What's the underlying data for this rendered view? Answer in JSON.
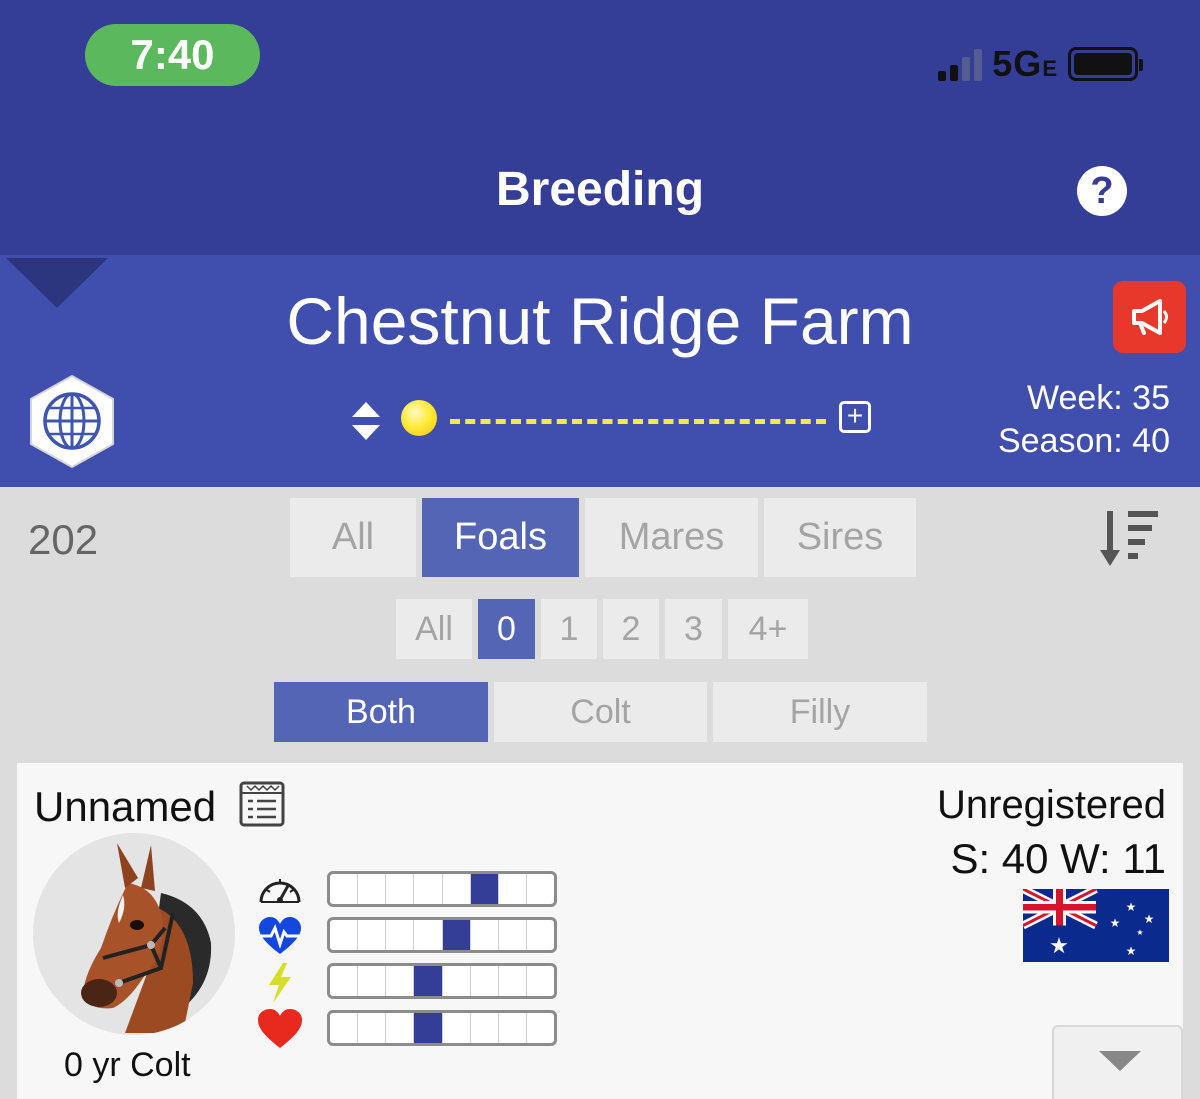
{
  "status_bar": {
    "time": "7:40",
    "network": "5G",
    "network_suffix": "E",
    "icons": [
      "signal-icon",
      "battery-icon"
    ]
  },
  "nav": {
    "title": "Breeding",
    "help_label": "?"
  },
  "farm": {
    "name": "Chestnut Ridge Farm",
    "week_label": "Week: 35",
    "season_label": "Season: 40",
    "plus_label": "+"
  },
  "filters": {
    "count": "202",
    "type_tabs": [
      {
        "label": "All",
        "active": false
      },
      {
        "label": "Foals",
        "active": true
      },
      {
        "label": "Mares",
        "active": false
      },
      {
        "label": "Sires",
        "active": false
      }
    ],
    "age_tabs": [
      {
        "label": "All",
        "active": false
      },
      {
        "label": "0",
        "active": true
      },
      {
        "label": "1",
        "active": false
      },
      {
        "label": "2",
        "active": false
      },
      {
        "label": "3",
        "active": false
      },
      {
        "label": "4+",
        "active": false
      }
    ],
    "sex_tabs": [
      {
        "label": "Both",
        "active": true
      },
      {
        "label": "Colt",
        "active": false
      },
      {
        "label": "Filly",
        "active": false
      }
    ]
  },
  "horse_card": {
    "name": "Unnamed",
    "age_sex": "0 yr Colt",
    "registration": "Unregistered",
    "season_week": "S: 40 W: 11",
    "flag": "australia-flag",
    "stats": [
      {
        "icon": "speedometer-icon",
        "level_cell": 5,
        "cells": 8
      },
      {
        "icon": "heartbeat-icon",
        "level_cell": 4,
        "cells": 8
      },
      {
        "icon": "lightning-icon",
        "level_cell": 3,
        "cells": 8
      },
      {
        "icon": "heart-icon",
        "level_cell": 3,
        "cells": 8
      }
    ]
  },
  "colors": {
    "nav_bg": "#343e96",
    "farm_bg": "#404fae",
    "accent": "#5565b5",
    "announce": "#e8382c",
    "time_pill": "#5cb85c"
  }
}
